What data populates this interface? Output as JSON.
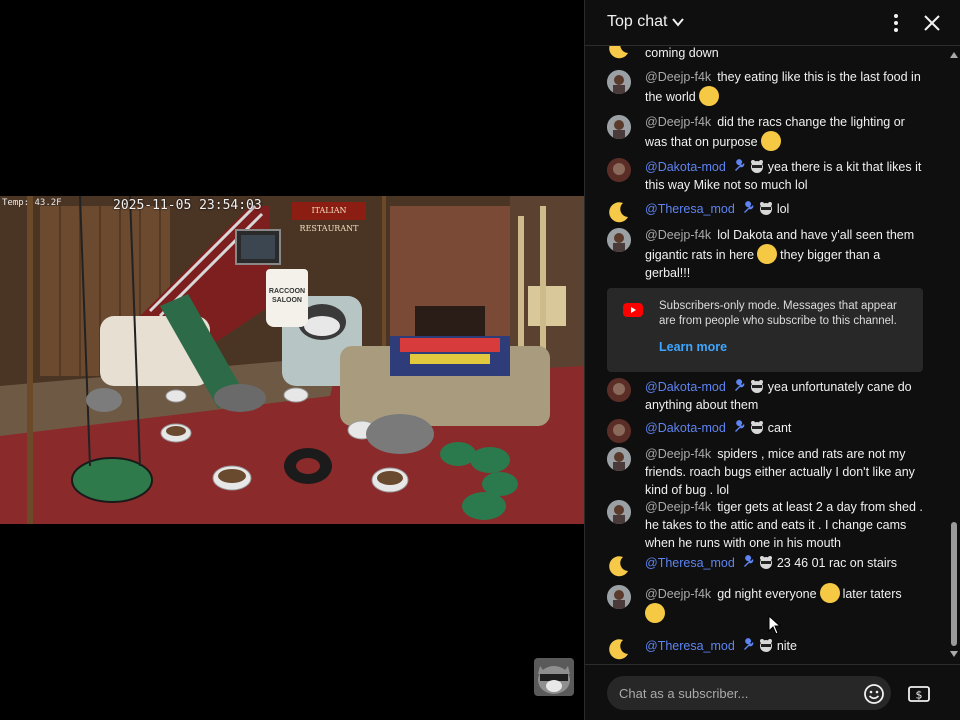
{
  "video": {
    "temperature": "Temp: 43.2F",
    "timestamp": "2025-11-05 23:54:03",
    "sign_text": "ITALIAN RESTAURANT",
    "bucket_text": "RACCOON SALOON"
  },
  "chat": {
    "title": "Top chat",
    "messages": [
      {
        "author": "",
        "text": "coming down",
        "avatar": "moon"
      },
      {
        "author": "@Deejp-f4k",
        "text": "they eating like this is the last food in the world",
        "emoji": "laughing-emoji",
        "avatar": "deejp"
      },
      {
        "author": "@Deejp-f4k",
        "text": "did the racs change the lighting or was that on purpose",
        "emoji": "thinking-emoji",
        "avatar": "deejp"
      },
      {
        "author": "@Dakota-mod",
        "text": "yea there is a kit that likes it this way Mike not so much lol",
        "avatar": "dakota",
        "mod": true
      },
      {
        "author": "@Theresa_mod",
        "text": "lol",
        "avatar": "moon",
        "mod": true
      },
      {
        "author": "@Deejp-f4k",
        "text_before": "lol Dakota and have y'all seen them gigantic rats in here",
        "text_after": "they bigger than a gerbal!!!",
        "emoji": "flushed-emoji",
        "avatar": "deejp"
      },
      {
        "author": "@Dakota-mod",
        "text": "yea unfortunately cane do anything about them",
        "avatar": "dakota",
        "mod": true
      },
      {
        "author": "@Dakota-mod",
        "text": "cant",
        "avatar": "dakota",
        "mod": true
      },
      {
        "author": "@Deejp-f4k",
        "text": "spiders , mice and rats are not my friends. roach bugs either actually I don't like any kind of bug . lol",
        "avatar": "deejp"
      },
      {
        "author": "@Deejp-f4k",
        "text": "tiger gets at least 2 a day from shed . he takes to the attic and eats it . I change cams when he runs with one in his mouth",
        "avatar": "deejp"
      },
      {
        "author": "@Theresa_mod",
        "text": "23 46 01 rac on stairs",
        "avatar": "moon",
        "mod": true
      },
      {
        "author": "@Deejp-f4k",
        "text_before": "gd night everyone",
        "text_after": "later taters",
        "emoji": "yawning-emoji",
        "emoji2": "grinning-squint-emoji",
        "avatar": "deejp"
      },
      {
        "author": "@Theresa_mod",
        "text": "nite",
        "avatar": "moon",
        "mod": true
      }
    ],
    "notice": {
      "text": "Subscribers-only mode. Messages that appear are from people who subscribe to this channel.",
      "link": "Learn more"
    },
    "input_placeholder": "Chat as a subscriber..."
  },
  "colors": {
    "panel_bg": "#0f0f0f",
    "mod_name": "#5e84f1",
    "author_name": "#aaaaaa",
    "link": "#3ea6ff"
  }
}
